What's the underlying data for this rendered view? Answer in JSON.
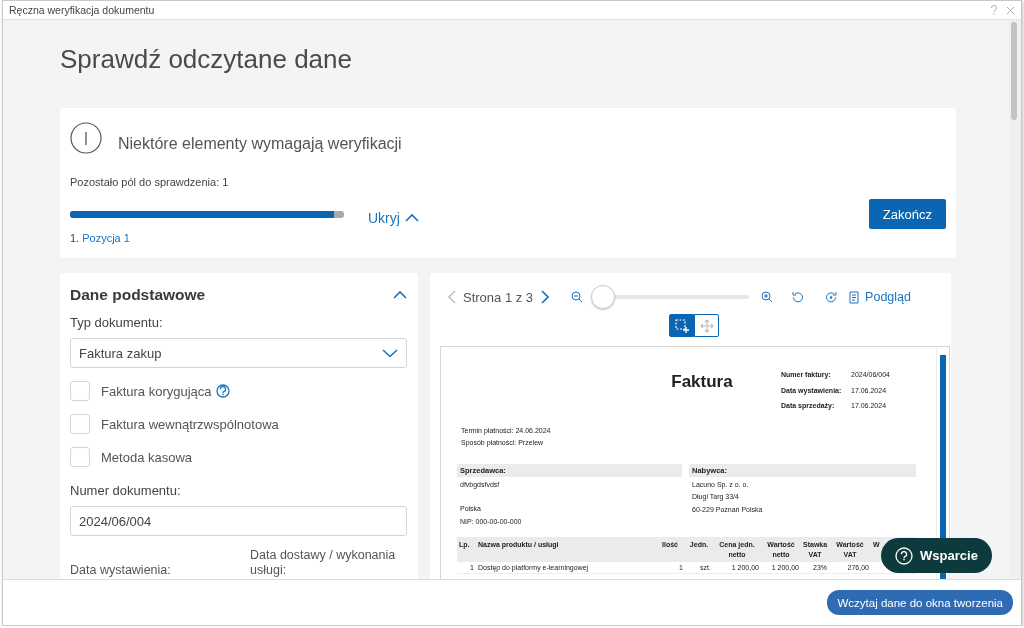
{
  "window": {
    "title": "Ręczna weryfikacja dokumentu"
  },
  "heading": "Sprawdź odczytane dane",
  "verification": {
    "message": "Niektóre elementy wymagają weryfikacji",
    "remaining": "Pozostało pól do sprawdzenia: 1",
    "progress": {
      "level": 0.965
    },
    "toggle": {
      "label": "Ukryj",
      "expanded": true
    },
    "items": [
      {
        "number": "1.",
        "label": "Pozycja 1"
      }
    ],
    "finish_button": "Zakończ"
  },
  "basic_data": {
    "title": "Dane podstawowe",
    "expanded": true,
    "document_type": {
      "label": "Typ dokumentu:",
      "value": "Faktura zakup"
    },
    "checkboxes": [
      {
        "label": "Faktura korygująca",
        "checked": false,
        "help": true
      },
      {
        "label": "Faktura wewnątrzwspólnotowa",
        "checked": false,
        "help": false
      },
      {
        "label": "Metoda kasowa",
        "checked": false,
        "help": false
      }
    ],
    "document_number": {
      "label": "Numer dokumentu:",
      "value": "2024/06/004"
    },
    "date_labels": [
      "Data wystawienia:",
      "Data dostawy / wykonania usługi:"
    ]
  },
  "viewer": {
    "page_text": "Strona 1 z 3",
    "prev_disabled": true,
    "zoom": {
      "level": 0
    },
    "preview_link": "Podgląd",
    "tools": [
      {
        "kind": "select",
        "selected": true
      },
      {
        "kind": "move",
        "selected": false
      }
    ],
    "invoice": {
      "title": "Faktura",
      "meta": [
        {
          "label": "Numer faktury:",
          "value": "2024/06/004"
        },
        {
          "label": "Data wystawienia:",
          "value": "17.06.2024"
        },
        {
          "label": "Data sprzedaży:",
          "value": "17.06.2024"
        }
      ],
      "payment": [
        "Termin płatności: 24.06.2024",
        "Sposób płatności: Przelew"
      ],
      "parties": [
        {
          "heading": "Sprzedawca:",
          "blocks": [
            [
              "dfvbgdsfvdsf"
            ],
            [
              "Polska",
              "NIP: 000-00-00-000"
            ]
          ]
        },
        {
          "heading": "Nabywca:",
          "blocks": [
            [
              "Lacuno Sp. z o. o.",
              "Długi Targ 33/4",
              "60-229 Poznań Polska"
            ]
          ]
        }
      ],
      "columns": [
        "Lp.",
        "Nazwa produktu / usługi",
        "Ilość",
        "Jedn.",
        "Cena jedn. netto",
        "Wartość netto",
        "Stawka VAT",
        "Wartość VAT",
        "W"
      ],
      "rows": [
        [
          "1",
          "Dostęp do platformy e-learningowej",
          "1",
          "szt.",
          "1 200,00",
          "1 200,00",
          "23%",
          "276,00"
        ]
      ]
    }
  },
  "support_button": "Wsparcie",
  "footer_button": "Wczytaj dane do okna tworzenia"
}
